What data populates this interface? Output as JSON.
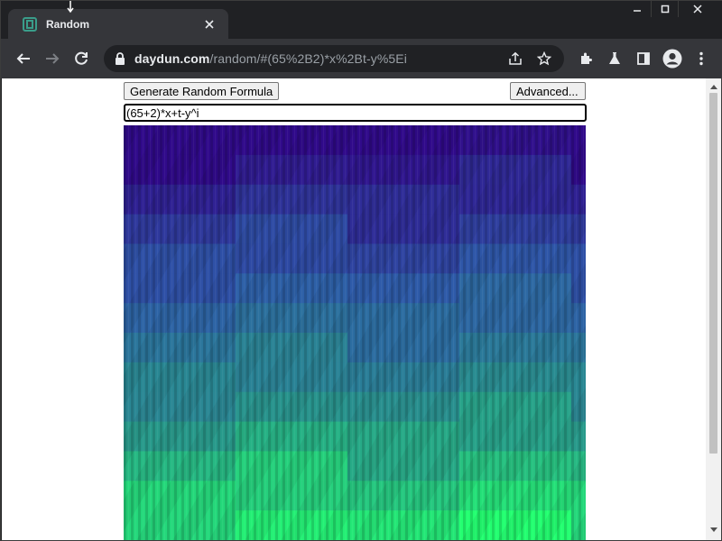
{
  "browser": {
    "tab": {
      "title": "Random",
      "favicon": "daydun-favicon"
    },
    "url_host": "daydun.com",
    "url_path": "/random/#(65%2B2)*x%2Bt-y%5Ei",
    "nav_icons": [
      "back-arrow-icon",
      "forward-arrow-icon",
      "reload-icon"
    ],
    "omnibox_icons": [
      "lock-icon",
      "share-icon",
      "star-icon"
    ],
    "toolbar_icons": [
      "extensions-icon",
      "labs-flask-icon",
      "side-panel-icon",
      "profile-avatar-icon",
      "menu-kebab-icon"
    ],
    "window_controls": [
      "minimize-icon",
      "restore-icon",
      "close-icon"
    ],
    "colors": {
      "chrome_dark": "#202124",
      "toolbar": "#35363a",
      "favicon_accent": "#3a9d8a"
    }
  },
  "page": {
    "generate_button": "Generate Random Formula",
    "advanced_button": "Advanced...",
    "formula_value": "(65+2)*x+t-y^i",
    "render": {
      "description_colors": {
        "dark": "#300a8a",
        "mid": "#2e6aa8",
        "bright": "#22ff70"
      }
    }
  }
}
